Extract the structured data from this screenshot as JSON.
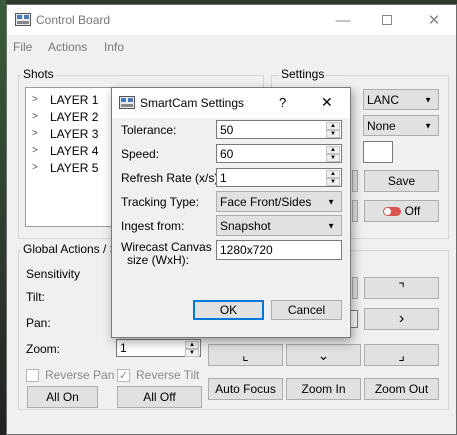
{
  "window": {
    "title": "Control Board"
  },
  "menu": [
    "File",
    "Actions",
    "Info"
  ],
  "shots": {
    "label": "Shots",
    "layers": [
      "LAYER 1",
      "LAYER 2",
      "LAYER 3",
      "LAYER 4",
      "LAYER 5"
    ]
  },
  "settings": {
    "label": "Settings",
    "protocol": "LANC",
    "option": "None",
    "save_label": "Save",
    "toggle_label": "Off"
  },
  "global_actions": {
    "label": "Global Actions / Se",
    "sensitivity": "Sensitivity",
    "tilt": "Tilt:",
    "pan": "Pan:",
    "zoom": "Zoom:",
    "zoom_value": "1",
    "reverse_pan": "Reverse Pan",
    "reverse_tilt": "Reverse Tilt",
    "all_on": "All On",
    "all_off": "All Off"
  },
  "nav": {
    "up_right": "⌝",
    "right": "›",
    "down_left": "⌞",
    "down": "⌄",
    "down_right": "⌟"
  },
  "focus_buttons": [
    "Auto Focus",
    "Zoom In",
    "Zoom Out"
  ],
  "dialog": {
    "title": "SmartCam Settings",
    "help": "?",
    "close": "✕",
    "tolerance_label": "Tolerance:",
    "tolerance": "50",
    "speed_label": "Speed:",
    "speed": "60",
    "refresh_label": "Refresh Rate (x/s):",
    "refresh": "1",
    "tracking_label": "Tracking Type:",
    "tracking": "Face Front/Sides",
    "ingest_label": "Ingest from:",
    "ingest": "Snapshot",
    "canvas_label_1": "Wirecast Canvas",
    "canvas_label_2": "size (WxH):",
    "canvas": "1280x720",
    "ok": "OK",
    "cancel": "Cancel"
  },
  "colors": {
    "accent": "#0078d7",
    "toggle_red": "#d9534f"
  }
}
